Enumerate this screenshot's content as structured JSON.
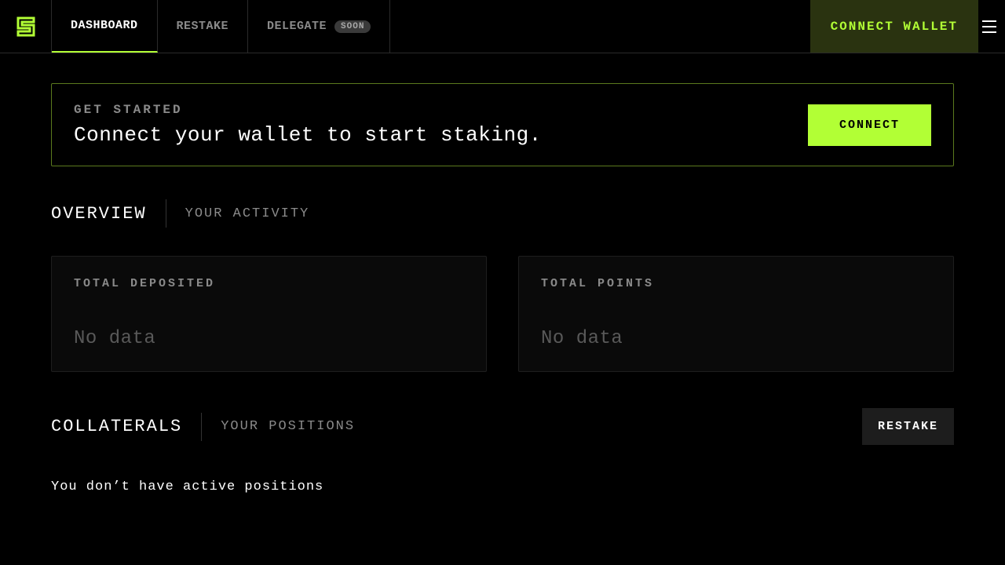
{
  "nav": {
    "items": [
      {
        "label": "DASHBOARD",
        "active": true
      },
      {
        "label": "RESTAKE",
        "active": false
      },
      {
        "label": "DELEGATE",
        "active": false,
        "badge": "SOON"
      }
    ],
    "connect_label": "CONNECT WALLET"
  },
  "banner": {
    "eyebrow": "GET STARTED",
    "title": "Connect your wallet to start staking.",
    "cta": "CONNECT"
  },
  "overview": {
    "tabs": [
      {
        "label": "OVERVIEW",
        "active": true
      },
      {
        "label": "YOUR ACTIVITY",
        "active": false
      }
    ],
    "cards": [
      {
        "label": "TOTAL DEPOSITED",
        "value": "No data"
      },
      {
        "label": "TOTAL POINTS",
        "value": "No data"
      }
    ]
  },
  "collaterals": {
    "tabs": [
      {
        "label": "COLLATERALS",
        "active": true
      },
      {
        "label": "YOUR POSITIONS",
        "active": false
      }
    ],
    "restake_label": "RESTAKE",
    "empty_message": "You don’t have active positions"
  },
  "colors": {
    "accent": "#b2ff35"
  }
}
